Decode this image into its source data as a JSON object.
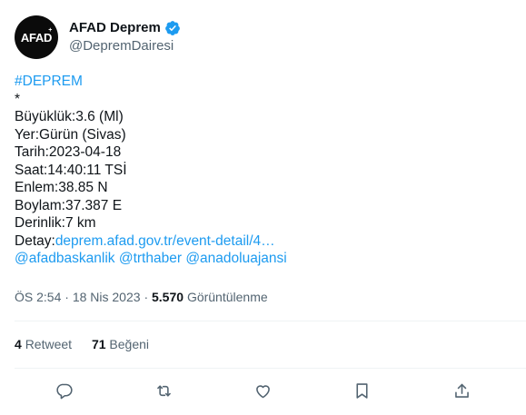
{
  "account": {
    "avatar_text": "AFAD",
    "display_name": "AFAD Deprem",
    "handle": "@DepremDairesi"
  },
  "tweet": {
    "hashtag": "#DEPREM",
    "lines": [
      "*",
      "Büyüklük:3.6 (Ml)",
      "Yer:Gürün (Sivas)",
      "Tarih:2023-04-18",
      "Saat:14:40:11 TSİ",
      "Enlem:38.85 N",
      "Boylam:37.387 E",
      "Derinlik:7 km"
    ],
    "detail_label": "Detay:",
    "detail_link": "deprem.afad.gov.tr/event-detail/4…",
    "mentions": [
      "@afadbaskanlik",
      "@trthaber",
      "@anadoluajansi"
    ]
  },
  "meta": {
    "time": "ÖS 2:54",
    "date": "18 Nis 2023",
    "views_count": "5.570",
    "views_label": "Görüntülenme"
  },
  "stats": {
    "retweet_count": "4",
    "retweet_label": "Retweet",
    "like_count": "71",
    "like_label": "Beğeni"
  },
  "actions": [
    "reply-icon",
    "retweet-icon",
    "like-icon",
    "bookmark-icon",
    "share-icon"
  ],
  "colors": {
    "link": "#1d9bf0",
    "text": "#0f1419",
    "secondary": "#536471",
    "divider": "#eff3f4"
  }
}
